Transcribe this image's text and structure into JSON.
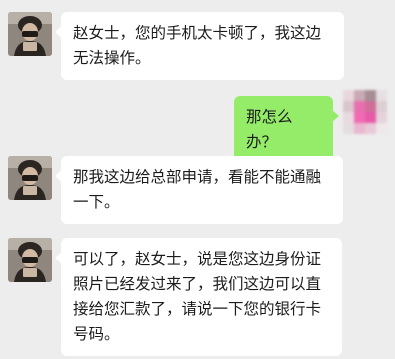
{
  "messages": [
    {
      "side": "left",
      "text": "赵女士，您的手机太卡顿了，我这边无法操作。"
    },
    {
      "side": "right",
      "text": "那怎么办？"
    },
    {
      "side": "left",
      "text": "那我这边给总部申请，看能不能通融一下。"
    },
    {
      "side": "left",
      "text": "可以了，赵女士，说是您这边身份证照片已经发过来了，我们这边可以直接给您汇款了，请说一下您的银行卡号码。"
    }
  ],
  "colors": {
    "background": "#ededed",
    "incoming_bubble": "#ffffff",
    "outgoing_bubble": "#95ec69"
  },
  "icons": {
    "contact_avatar": "person-photo-avatar",
    "self_avatar": "pixelated-avatar"
  }
}
